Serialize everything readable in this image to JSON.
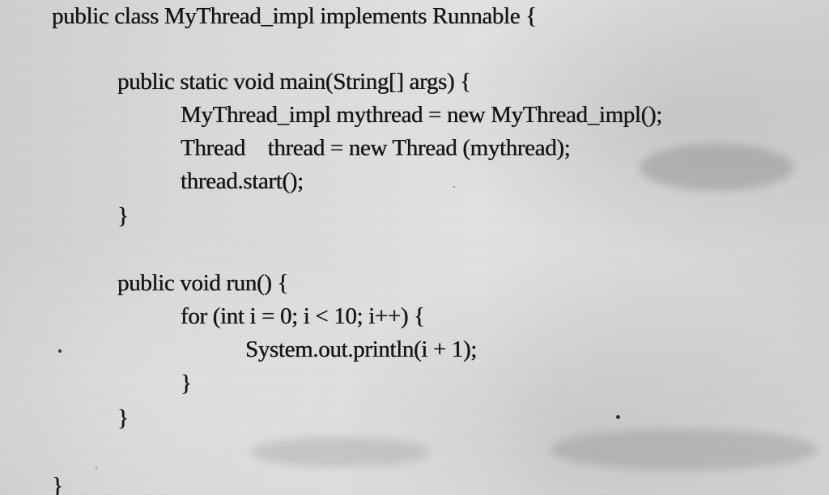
{
  "code": {
    "lines": [
      "public class MyThread_impl implements Runnable {",
      "public static void main(String[] args) {",
      "MyThread_impl mythread = new MyThread_impl();",
      "Thread    thread = new Thread (mythread);",
      "thread.start();",
      "}",
      "public void run() {",
      "for (int i = 0; i < 10; i++) {",
      "System.out.println(i + 1);",
      "}",
      "}",
      "}"
    ]
  }
}
